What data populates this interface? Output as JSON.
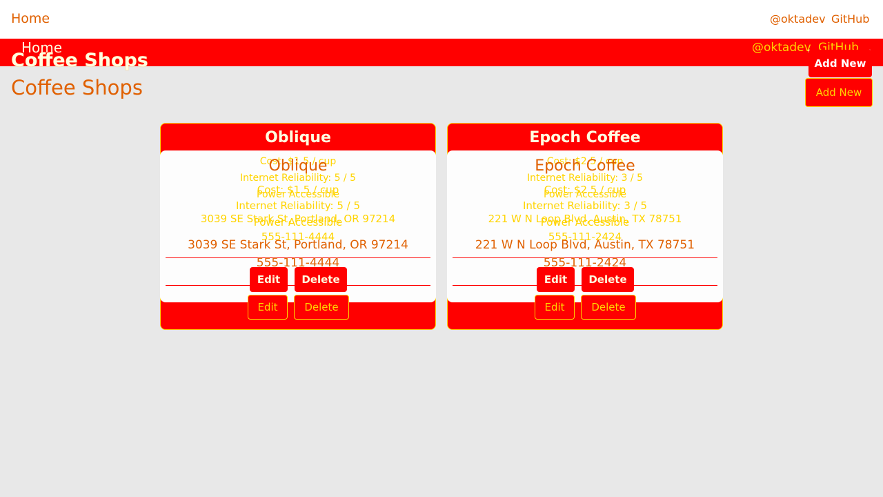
{
  "nav": {
    "home": "Home",
    "twitter": "@oktadev",
    "github": "GitHub",
    "separator": ","
  },
  "page": {
    "title": "Coffee Shops",
    "add_new": "Add New"
  },
  "actions": {
    "edit": "Edit",
    "delete": "Delete"
  },
  "shops": [
    {
      "name": "Oblique",
      "cost": "Cost: $1.5 / cup",
      "internet": "Internet Reliability: 5 / 5",
      "power": "Power Accessible",
      "address": "3039 SE Stark St, Portland, OR 97214",
      "phone": "555-111-4444"
    },
    {
      "name": "Epoch Coffee",
      "cost": "Cost: $2.5 / cup",
      "internet": "Internet Reliability: 3 / 5",
      "power": "Power Accessible",
      "address": "221 W N Loop Blvd, Austin, TX 78751",
      "phone": "555-111-2424"
    }
  ]
}
